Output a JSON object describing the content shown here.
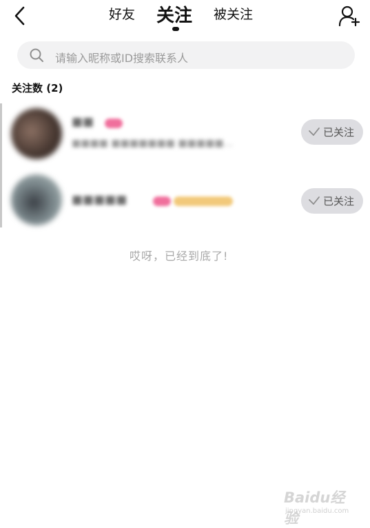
{
  "header": {
    "tabs": [
      {
        "label": "好友"
      },
      {
        "label": "关注"
      },
      {
        "label": "被关注"
      }
    ]
  },
  "search": {
    "placeholder": "请输入昵称或ID搜索联系人"
  },
  "section": {
    "title": "关注数 (2)"
  },
  "users": [
    {
      "name": "■■",
      "description": "■■■■ ■■■■■■■ ■■■■■...",
      "button_label": "已关注"
    },
    {
      "name": "■■■■■",
      "description": "",
      "button_label": "已关注"
    }
  ],
  "footer": {
    "end_text": "哎呀，已经到底了!"
  },
  "watermark": {
    "logo": "Baidu经验",
    "sub": "jingyan.baidu.com"
  },
  "colors": {
    "accent_pink": "#f06f9c",
    "badge_gold": "#f2c97a",
    "button_bg": "#dddde1"
  }
}
